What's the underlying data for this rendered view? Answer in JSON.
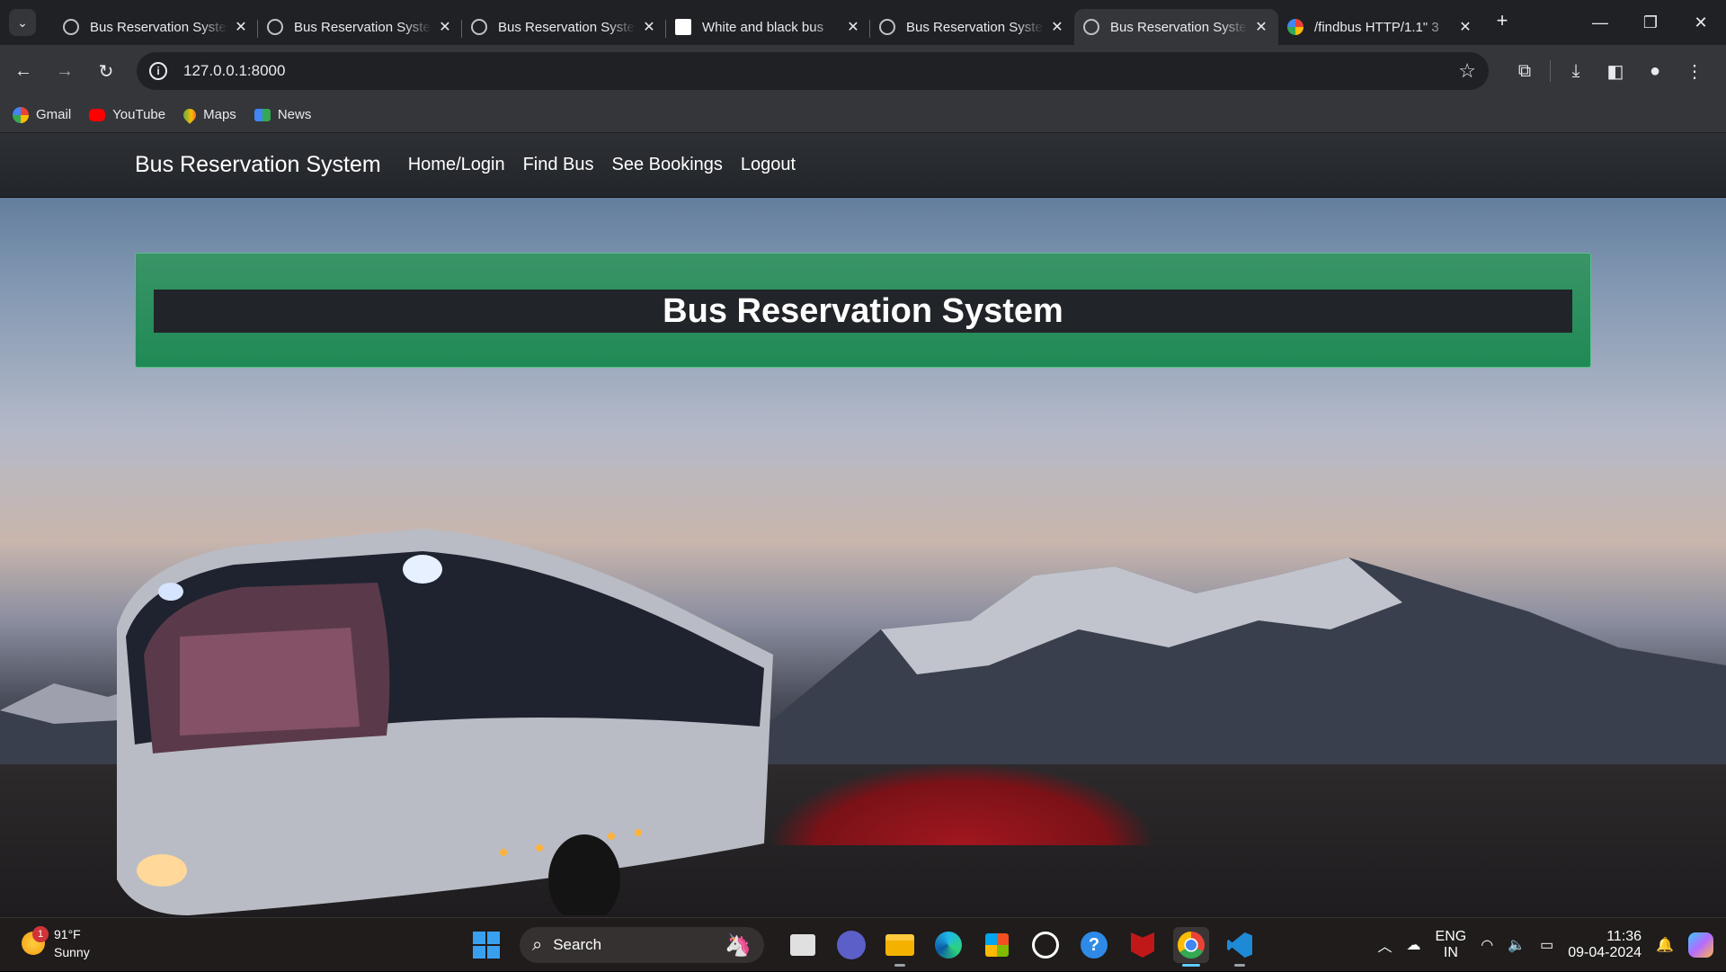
{
  "browser": {
    "tabs": [
      {
        "title": "Bus Reservation System",
        "favicon": "globe-icon",
        "active": false
      },
      {
        "title": "Bus Reservation System",
        "favicon": "globe-icon",
        "active": false
      },
      {
        "title": "Bus Reservation System",
        "favicon": "globe-icon",
        "active": false
      },
      {
        "title": "White and black bus",
        "favicon": "image-icon",
        "active": false
      },
      {
        "title": "Bus Reservation System",
        "favicon": "globe-icon",
        "active": false
      },
      {
        "title": "Bus Reservation System",
        "favicon": "globe-icon",
        "active": true
      },
      {
        "title": "/findbus HTTP/1.1\" 3",
        "favicon": "google-icon",
        "active": false
      }
    ],
    "url": "127.0.0.1:8000",
    "bookmarks": [
      {
        "label": "Gmail",
        "icon": "google-icon",
        "color": "#4285f4"
      },
      {
        "label": "YouTube",
        "icon": "youtube-icon",
        "color": "#ff0000"
      },
      {
        "label": "Maps",
        "icon": "maps-icon",
        "color": "#34a853"
      },
      {
        "label": "News",
        "icon": "news-icon",
        "color": "#4285f4"
      }
    ]
  },
  "site": {
    "brand": "Bus Reservation System",
    "nav": {
      "home": "Home/Login",
      "find": "Find Bus",
      "bookings": "See Bookings",
      "logout": "Logout"
    },
    "hero_title": "Bus Reservation System",
    "colors": {
      "hero_bg": "#28945e",
      "title_bar": "#212529",
      "navbar": "#2b2e33"
    }
  },
  "taskbar": {
    "weather": {
      "temp": "91°F",
      "condition": "Sunny",
      "badge": "1"
    },
    "search_label": "Search",
    "tray": {
      "lang_line1": "ENG",
      "lang_line2": "IN",
      "time": "11:36",
      "date": "09-04-2024"
    }
  }
}
